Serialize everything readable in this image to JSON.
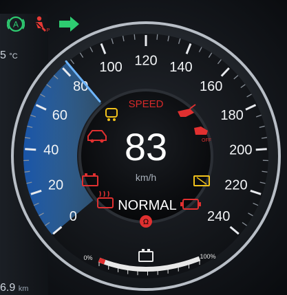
{
  "left_panel": {
    "temp_value": "5",
    "temp_unit": "°C",
    "odo_value": "6.9",
    "odo_unit": "km"
  },
  "top_icons": [
    {
      "name": "auto-hold-icon",
      "label": "A",
      "color": "#2ecc71"
    },
    {
      "name": "seatbelt-warning-icon",
      "label": "P",
      "color": "#e53935"
    },
    {
      "name": "turn-right-arrow-icon",
      "color": "#2ecc71"
    }
  ],
  "gauge": {
    "speed_value": "83",
    "unit": "km/h",
    "mode_label": "NORMAL",
    "header_label": "SPEED",
    "min": 0,
    "max": 240,
    "ticks": [
      "0",
      "20",
      "40",
      "60",
      "80",
      "100",
      "120",
      "140",
      "160",
      "180",
      "200",
      "220",
      "240"
    ]
  },
  "fuel": {
    "empty_label": "0%",
    "full_label": "100%",
    "level_percent": 6
  },
  "colors": {
    "accent_blue": "#2f8fff",
    "warning_red": "#e03030",
    "amber": "#f2c21b"
  }
}
